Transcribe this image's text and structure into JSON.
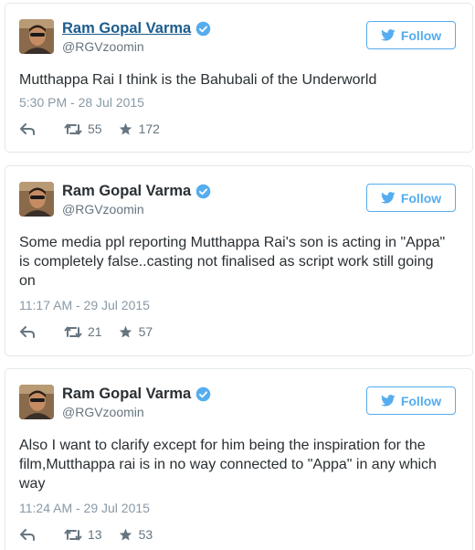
{
  "colors": {
    "accent": "#55acee",
    "name_link": "#1b5c8c",
    "text": "#292f33",
    "muted": "#8899a6",
    "border": "#e1e8ed"
  },
  "tweets": [
    {
      "display_name": "Ram Gopal Varma",
      "handle": "@RGVzoomin",
      "verified": true,
      "follow_label": "Follow",
      "text": "Mutthappa Rai I think is the Bahubali of the Underworld",
      "timestamp": "5:30 PM - 28 Jul 2015",
      "retweets": "55",
      "favorites": "172"
    },
    {
      "display_name": "Ram Gopal Varma",
      "handle": "@RGVzoomin",
      "verified": true,
      "follow_label": "Follow",
      "text": "Some media ppl reporting Mutthappa Rai's son is acting in \"Appa\" is completely false..casting not finalised as script work still going on",
      "timestamp": "11:17 AM - 29 Jul 2015",
      "retweets": "21",
      "favorites": "57"
    },
    {
      "display_name": "Ram Gopal Varma",
      "handle": "@RGVzoomin",
      "verified": true,
      "follow_label": "Follow",
      "text": "Also I want to clarify except for him being the inspiration for the film,Mutthappa rai is in no way connected to \"Appa\" in any which way",
      "timestamp": "11:24 AM - 29 Jul 2015",
      "retweets": "13",
      "favorites": "53"
    }
  ],
  "icons": {
    "avatar": "avatar-photo",
    "verified": "verified-badge-icon",
    "follow": "twitter-bird-icon",
    "reply": "reply-icon",
    "retweet": "retweet-icon",
    "favorite": "star-icon"
  }
}
